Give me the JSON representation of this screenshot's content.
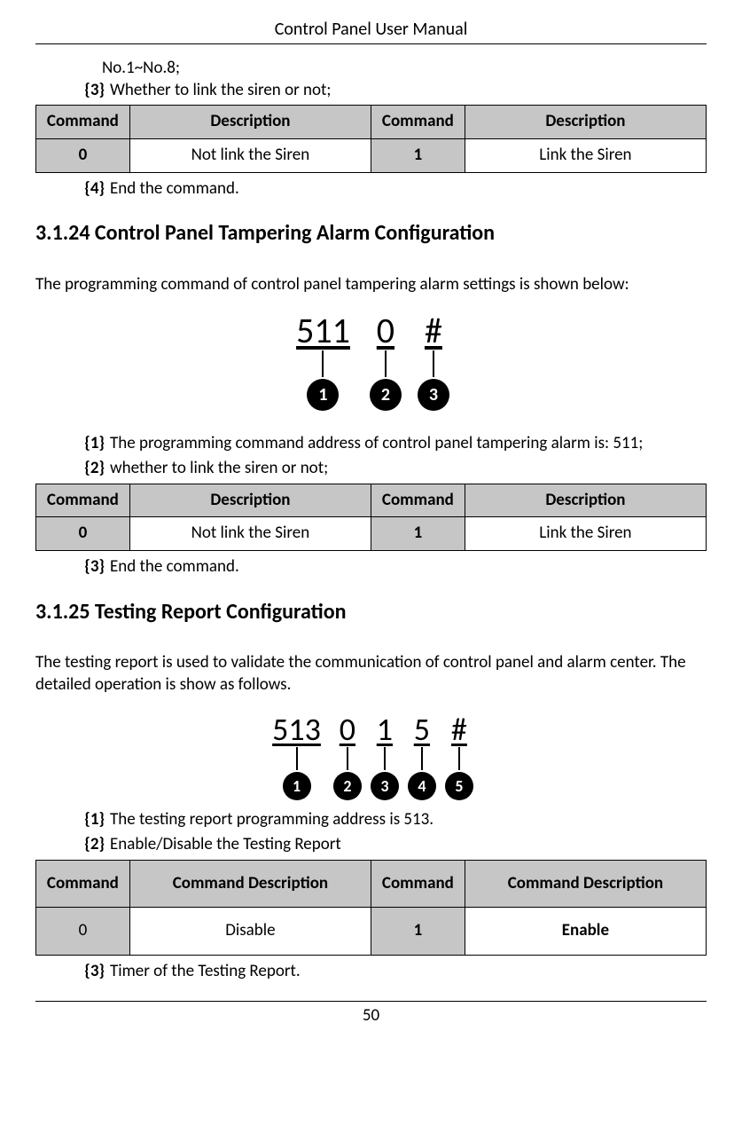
{
  "header": {
    "title": "Control Panel User Manual"
  },
  "prelude": {
    "line1": "No.1~No.8;",
    "item3_label": "{3}",
    "item3_text": "Whether to link the siren or not;",
    "item4_label": "{4}",
    "item4_text": "End the command."
  },
  "table_a": {
    "h1": "Command",
    "h2": "Description",
    "h3": "Command",
    "h4": "Description",
    "r1c1": "0",
    "r1c2": "Not link the Siren",
    "r1c3": "1",
    "r1c4": "Link the Siren"
  },
  "sec24": {
    "heading": "3.1.24 Control Panel Tampering Alarm Configuration",
    "intro": "The programming command of control panel tampering alarm settings is shown below:",
    "seg1": "511",
    "seg2": "0",
    "seg3": "#",
    "n1": "1",
    "n2": "2",
    "n3": "3",
    "item1_label": "{1}",
    "item1_text": "The programming command address of control panel tampering alarm is: 511;",
    "item2_label": "{2}",
    "item2_text": "whether to link the siren or not;",
    "item3_label": "{3}",
    "item3_text": "End the command."
  },
  "table_b": {
    "h1": "Command",
    "h2": "Description",
    "h3": "Command",
    "h4": "Description",
    "r1c1": "0",
    "r1c2": "Not link the Siren",
    "r1c3": "1",
    "r1c4": "Link the Siren"
  },
  "sec25": {
    "heading": "3.1.25 Testing Report Configuration",
    "intro": "The testing report is used to validate the communication of control panel and alarm center. The detailed operation is show as follows.",
    "seg1": "513",
    "seg2": "0",
    "seg3": "1",
    "seg4": "5",
    "seg5": "#",
    "n1": "1",
    "n2": "2",
    "n3": "3",
    "n4": "4",
    "n5": "5",
    "item1_label": "{1}",
    "item1_text": "The testing report programming address is 513.",
    "item2_label": "{2}",
    "item2_text": "Enable/Disable the Testing Report",
    "item3_label": "{3}",
    "item3_text": "Timer of the Testing Report."
  },
  "table_c": {
    "h1": "Command",
    "h2": "Command Description",
    "h3": "Command",
    "h4": "Command Description",
    "r1c1": "0",
    "r1c2": "Disable",
    "r1c3": "1",
    "r1c4": "Enable"
  },
  "page_number": "50",
  "chart_data": [
    {
      "type": "table",
      "title": "Siren link command codes (section 3.1.23 continued)",
      "columns": [
        "Command",
        "Description"
      ],
      "rows": [
        [
          "0",
          "Not link the Siren"
        ],
        [
          "1",
          "Link the Siren"
        ]
      ]
    },
    {
      "type": "table",
      "title": "Control panel tampering alarm — siren link codes",
      "columns": [
        "Command",
        "Description"
      ],
      "rows": [
        [
          "0",
          "Not link the Siren"
        ],
        [
          "1",
          "Link the Siren"
        ]
      ]
    },
    {
      "type": "table",
      "title": "Testing report enable/disable codes",
      "columns": [
        "Command",
        "Command Description"
      ],
      "rows": [
        [
          "0",
          "Disable"
        ],
        [
          "1",
          "Enable"
        ]
      ]
    }
  ]
}
